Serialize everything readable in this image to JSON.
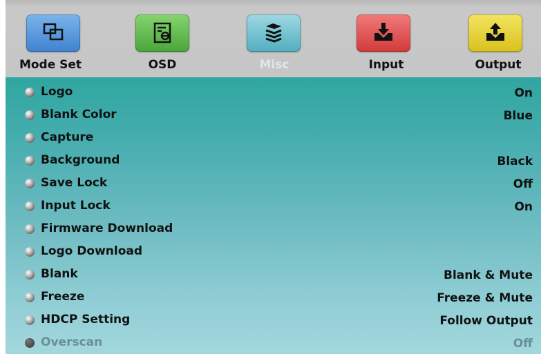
{
  "tabs": [
    {
      "label": "Mode Set",
      "icon": "mode-set-windows-icon",
      "color": "#4a90d9",
      "active": false
    },
    {
      "label": "OSD",
      "icon": "osd-document-icon",
      "color": "#58b849",
      "active": false
    },
    {
      "label": "Misc",
      "icon": "misc-stack-icon",
      "color": "#5fb8c9",
      "active": true
    },
    {
      "label": "Input",
      "icon": "input-download-tray-icon",
      "color": "#e24a4a",
      "active": false
    },
    {
      "label": "Output",
      "icon": "output-upload-tray-icon",
      "color": "#e8d22c",
      "active": false
    }
  ],
  "menu": {
    "items": [
      {
        "label": "Logo",
        "value": "On",
        "enabled": true
      },
      {
        "label": "Blank Color",
        "value": "Blue",
        "enabled": true
      },
      {
        "label": "Capture",
        "value": "",
        "enabled": true
      },
      {
        "label": "Background",
        "value": "Black",
        "enabled": true
      },
      {
        "label": "Save Lock",
        "value": "Off",
        "enabled": true
      },
      {
        "label": "Input Lock",
        "value": "On",
        "enabled": true
      },
      {
        "label": "Firmware Download",
        "value": "",
        "enabled": true
      },
      {
        "label": "Logo Download",
        "value": "",
        "enabled": true
      },
      {
        "label": "Blank",
        "value": "Blank & Mute",
        "enabled": true
      },
      {
        "label": "Freeze",
        "value": "Freeze & Mute",
        "enabled": true
      },
      {
        "label": "HDCP Setting",
        "value": "Follow Output",
        "enabled": true
      },
      {
        "label": "Overscan",
        "value": "Off",
        "enabled": false
      }
    ]
  }
}
